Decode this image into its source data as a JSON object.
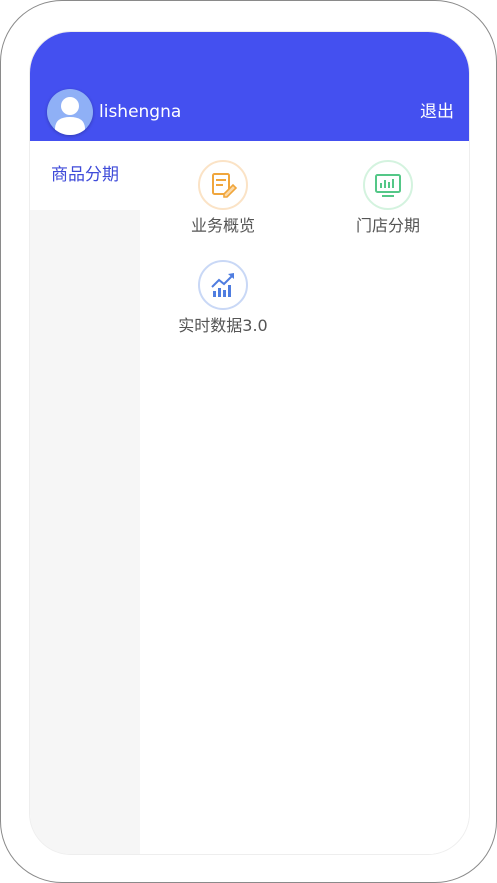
{
  "header": {
    "username": "lishengna",
    "logout_label": "退出",
    "avatar_icon": "user-avatar-icon",
    "background_color": "#4450f0"
  },
  "sidebar": {
    "items": [
      {
        "label": "商品分期",
        "selected": true
      }
    ]
  },
  "tiles": [
    {
      "label": "业务概览",
      "icon": "document-edit-icon",
      "color": "#f0a63c"
    },
    {
      "label": "门店分期",
      "icon": "monitor-chart-icon",
      "color": "#54c787"
    },
    {
      "label": "实时数据3.0",
      "icon": "trend-chart-icon",
      "color": "#4f7de0"
    }
  ]
}
